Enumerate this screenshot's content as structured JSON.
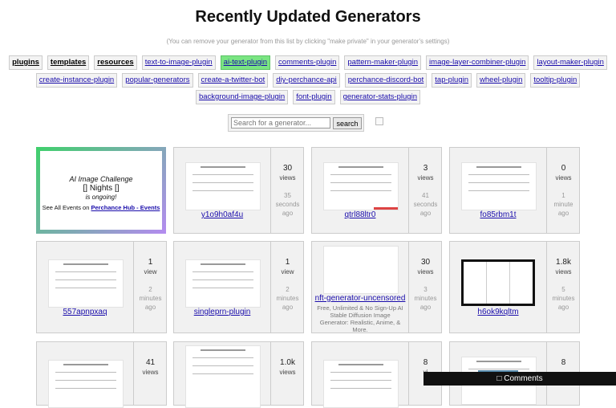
{
  "page": {
    "title": "Recently Updated Generators",
    "subtitle": "(You can remove your generator from this list by clicking \"make private\" in your generator's settings)"
  },
  "tags_row1": [
    "plugins",
    "templates",
    "resources",
    "text-to-image-plugin",
    "ai-text-plugin",
    "comments-plugin",
    "pattern-maker-plugin",
    "image-layer-combiner-plugin",
    "layout-maker-plugin"
  ],
  "tags_row2": [
    "create-instance-plugin",
    "popular-generators",
    "create-a-twitter-bot",
    "diy-perchance-api",
    "perchance-discord-bot",
    "tap-plugin",
    "wheel-plugin",
    "tooltip-plugin"
  ],
  "tags_row3": [
    "background-image-plugin",
    "font-plugin",
    "generator-stats-plugin"
  ],
  "search": {
    "placeholder": "Search for a generator...",
    "button": "search"
  },
  "promo": {
    "line1": "AI Image Challenge",
    "line2": "[] Nights []",
    "line3": "is ongoing!",
    "line4_prefix": "See All Events on",
    "line4_link": "Perchance Hub - Events"
  },
  "cards": [
    {
      "name": "y1o9h0af4u",
      "count": "30",
      "unit": "views",
      "ago": [
        "35",
        "seconds",
        "ago"
      ]
    },
    {
      "name": "qtrl88ltr0",
      "count": "3",
      "unit": "views",
      "ago": [
        "41",
        "seconds",
        "ago"
      ]
    },
    {
      "name": "fo85rbm1t",
      "count": "0",
      "unit": "views",
      "ago": [
        "1",
        "minute",
        "ago"
      ]
    },
    {
      "name": "557apnpxaq",
      "count": "1",
      "unit": "view",
      "ago": [
        "2",
        "minutes",
        "ago"
      ]
    },
    {
      "name": "singleprn-plugin",
      "count": "1",
      "unit": "view",
      "ago": [
        "2",
        "minutes",
        "ago"
      ]
    },
    {
      "name": "nft-generator-uncensored",
      "desc": "Free, Unlimited & No Sign-Up AI Stable Diffusion Image Generator: Realistic, Anime, & More.",
      "count": "30",
      "unit": "views",
      "ago": [
        "3",
        "minutes",
        "ago"
      ]
    },
    {
      "name": "h6ok9kqltm",
      "count": "1.8k",
      "unit": "views",
      "ago": [
        "5",
        "minutes",
        "ago"
      ]
    },
    {
      "name": "",
      "count": "41",
      "unit": "views",
      "ago": [
        "",
        "",
        ""
      ]
    },
    {
      "name": "",
      "count": "1.0k",
      "unit": "views",
      "ago": [
        "",
        "",
        ""
      ]
    },
    {
      "name": "",
      "count": "8",
      "unit": "vi",
      "ago": [
        "",
        "",
        ""
      ]
    },
    {
      "name": "",
      "count": "8",
      "unit": "",
      "ago": [
        "",
        "",
        ""
      ]
    }
  ],
  "comments": {
    "label": "Comments",
    "icon": "comment-icon"
  }
}
